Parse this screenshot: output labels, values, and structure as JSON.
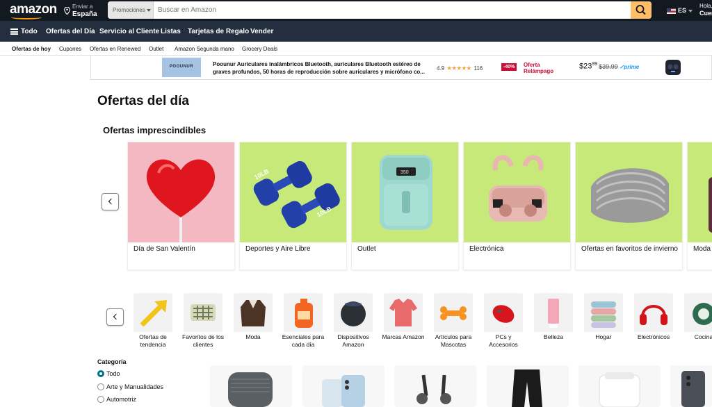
{
  "header": {
    "logo": "amazon",
    "deliver_line1": "Enviar a",
    "deliver_line2": "España",
    "search_category": "Promociones",
    "search_placeholder": "Buscar en Amazon",
    "language": "ES",
    "account_line1": "Hola,",
    "account_line2": "Cuen"
  },
  "nav": {
    "all_label": "Todo",
    "items": [
      "Ofertas del Día",
      "Servicio al Cliente",
      "Listas",
      "Tarjetas de Regalo",
      "Vender"
    ]
  },
  "subnav": {
    "items": [
      "Ofertas de hoy",
      "Cupones",
      "Ofertas en Renewed",
      "Outlet",
      "Amazon Segunda mano",
      "Grocery Deals"
    ]
  },
  "ad": {
    "brand": "POOUNUR",
    "description": "Poounur Auriculares inalámbricos Bluetooth, auriculares Bluetooth estéreo de graves profundos, 50 horas de reproducción sobre auriculares y micrófono co...",
    "rating": "4.9",
    "stars": "★★★★★",
    "reviews": "116",
    "discount": "-40%",
    "deal_line1": "Oferta",
    "deal_line2": "Relámpago",
    "price_whole": "$23",
    "price_cents": "99",
    "old_price": "$39.99",
    "prime": "✓prime"
  },
  "page_title": "Ofertas del día",
  "section_title": "Ofertas imprescindibles",
  "deal_cards": [
    {
      "label": "Día de San Valentín"
    },
    {
      "label": "Deportes y Aire Libre"
    },
    {
      "label": "Outlet"
    },
    {
      "label": "Electrónica"
    },
    {
      "label": "Ofertas en favoritos de invierno"
    },
    {
      "label": "Moda"
    }
  ],
  "dumbbell_text": "10LB",
  "airfryer_display": "350",
  "categories": [
    {
      "label": "Ofertas de tendencia"
    },
    {
      "label": "Favoritos de los clientes"
    },
    {
      "label": "Moda"
    },
    {
      "label": "Esenciales para cada día"
    },
    {
      "label": "Dispositivos Amazon"
    },
    {
      "label": "Marcas Amazon"
    },
    {
      "label": "Artículos para Mascotas"
    },
    {
      "label": "PCs y Accesorios"
    },
    {
      "label": "Belleza"
    },
    {
      "label": "Hogar"
    },
    {
      "label": "Electrónicos"
    },
    {
      "label": "Cocina"
    }
  ],
  "filters": {
    "title": "Categoría",
    "options": [
      "Todo",
      "Arte y Manualidades",
      "Automotriz"
    ]
  }
}
